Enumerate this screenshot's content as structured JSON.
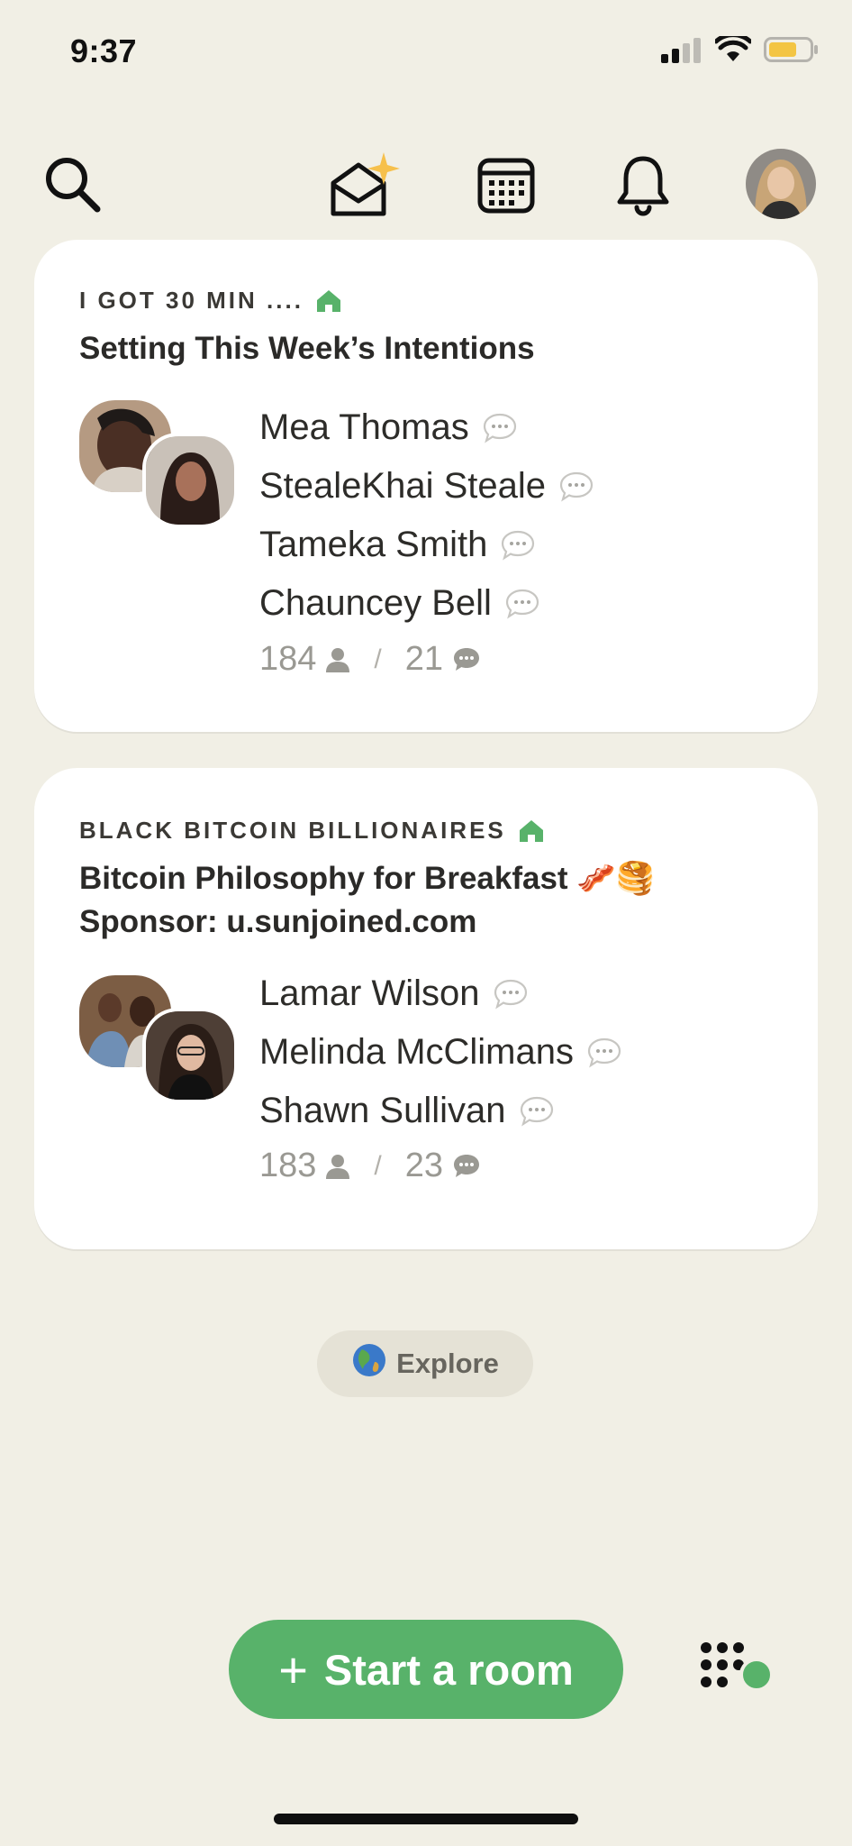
{
  "status_bar": {
    "time": "9:37"
  },
  "colors": {
    "background": "#F1EFE5",
    "accent_green": "#58B26A",
    "card": "#FFFFFF",
    "muted": "#9A9993"
  },
  "icons": {
    "search": "search-icon",
    "invite": "invite-envelope-sparkle-icon",
    "calendar": "calendar-icon",
    "notifications": "bell-icon",
    "profile": "avatar",
    "club_home": "house-icon",
    "speaker_chat": "chat-bubble-icon",
    "listeners": "person-icon",
    "messages": "message-icon",
    "explore": "globe-icon",
    "grid": "dot-grid-icon"
  },
  "rooms": [
    {
      "club": "I GOT 30 MIN ....",
      "title": "Setting This Week’s Intentions",
      "speakers": [
        "Mea Thomas",
        "StealeKhai Steale",
        "Tameka Smith",
        "Chauncey Bell"
      ],
      "listeners": "184",
      "messages": "21"
    },
    {
      "club": "BLACK BITCOIN BILLIONAIRES",
      "title": "Bitcoin Philosophy for Breakfast",
      "title_emoji": "🥓🥞",
      "subtitle": "Sponsor: u.sunjoined.com",
      "speakers": [
        "Lamar Wilson",
        "Melinda McClimans",
        "Shawn Sullivan"
      ],
      "listeners": "183",
      "messages": "23"
    }
  ],
  "explore": {
    "label": "Explore",
    "emoji": "🌏"
  },
  "start_room": {
    "plus": "+",
    "label": "Start a room"
  },
  "counts_separator": "/"
}
